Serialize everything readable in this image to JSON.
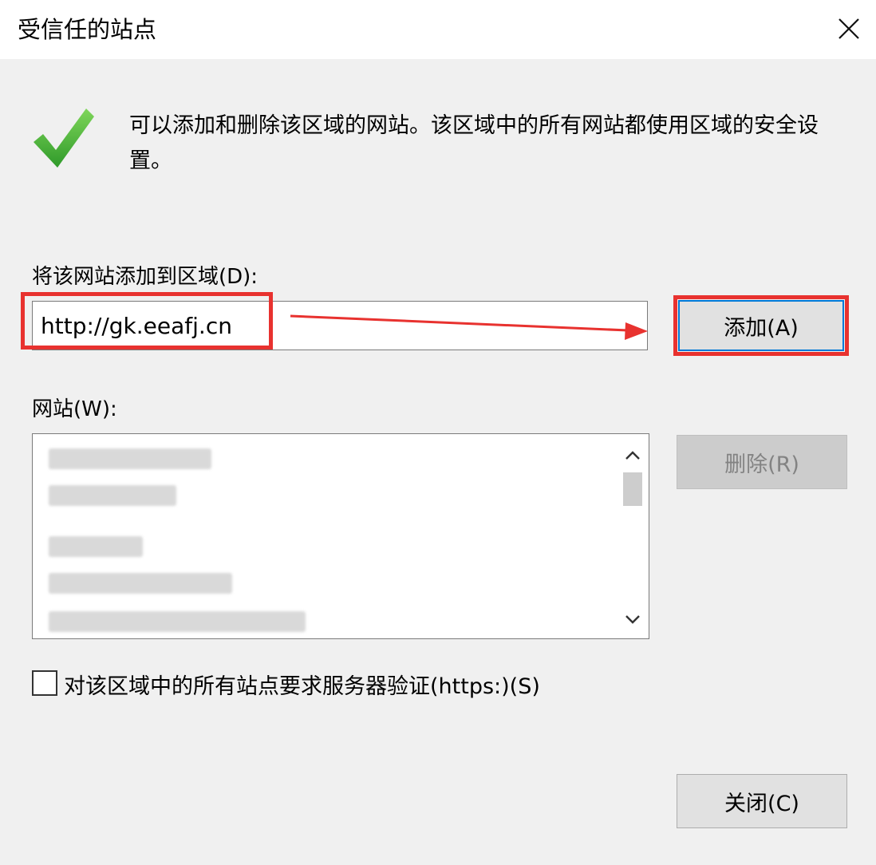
{
  "window": {
    "title": "受信任的站点",
    "close_icon": "close-icon"
  },
  "description": "可以添加和删除该区域的网站。该区域中的所有网站都使用区域的安全设置。",
  "add_section": {
    "label": "将该网站添加到区域(D):",
    "url_value": "http://gk.eeafj.cn",
    "add_button_label": "添加(A)"
  },
  "websites_section": {
    "label": "网站(W):",
    "remove_button_label": "删除(R)"
  },
  "checkbox": {
    "label": "对该区域中的所有站点要求服务器验证(https:)(S)",
    "checked": false
  },
  "close_button_label": "关闭(C)",
  "colors": {
    "highlight": "#e8322f",
    "check_green": "#3cb043",
    "focus_border": "#0078d7"
  }
}
